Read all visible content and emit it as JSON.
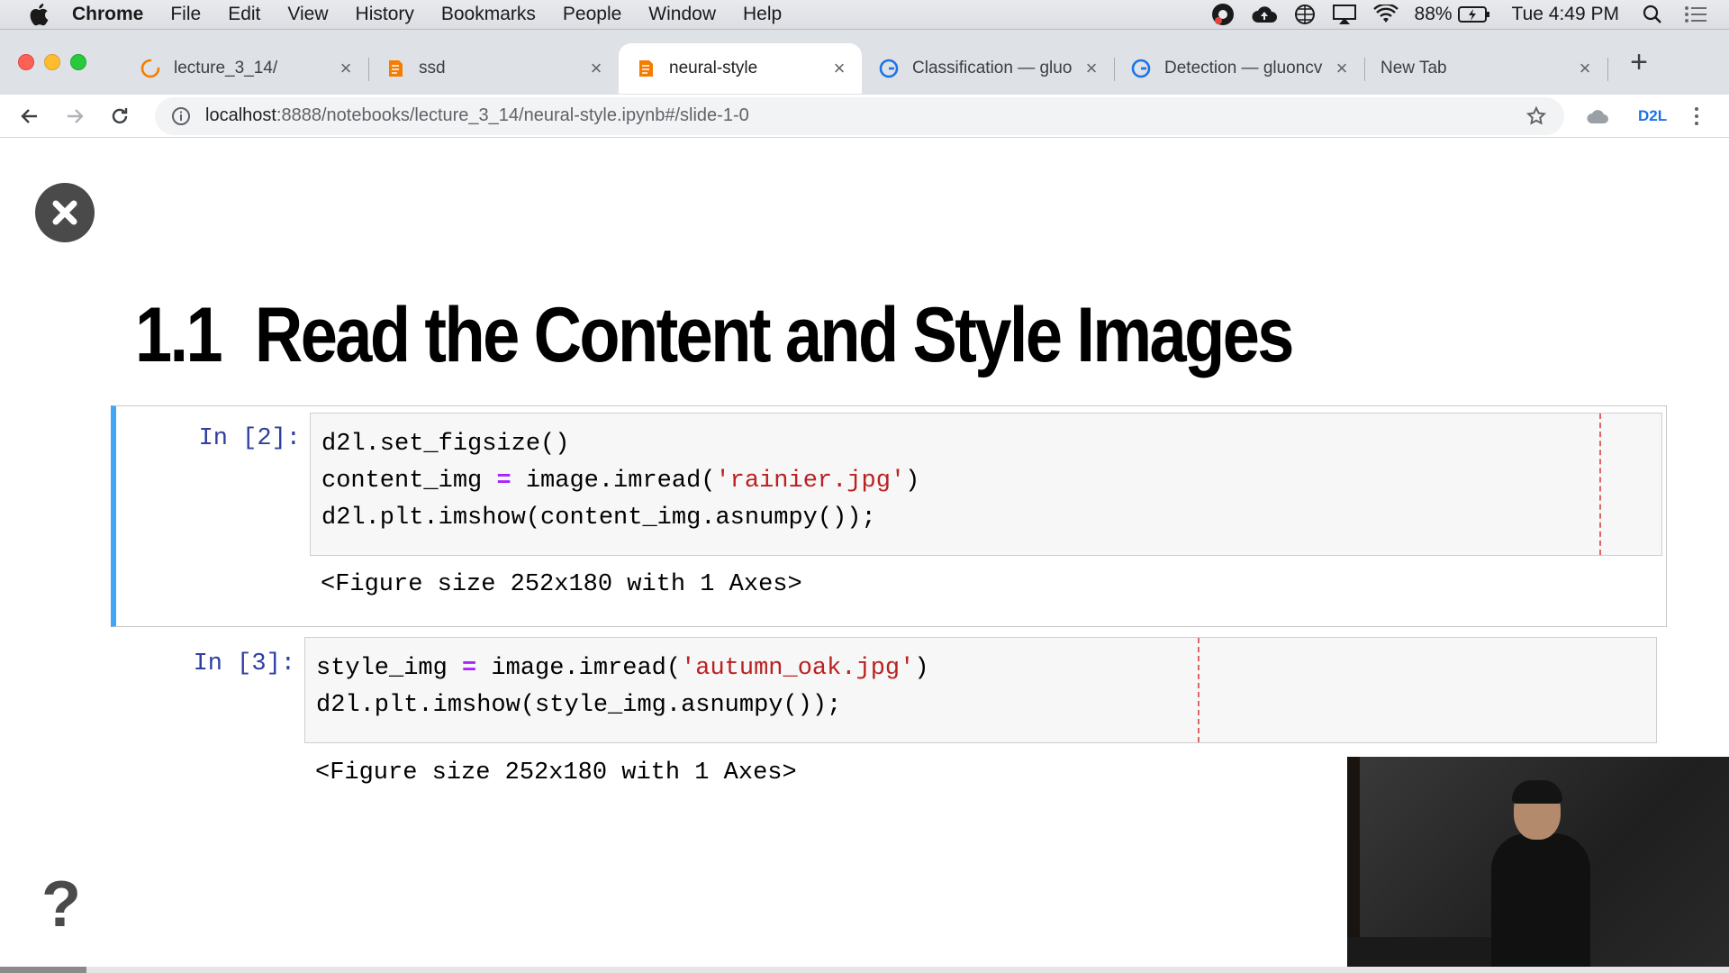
{
  "menubar": {
    "app": "Chrome",
    "items": [
      "File",
      "Edit",
      "View",
      "History",
      "Bookmarks",
      "People",
      "Window",
      "Help"
    ],
    "battery": "88%",
    "clock": "Tue 4:49 PM"
  },
  "tabs": [
    {
      "title": "lecture_3_14/",
      "icon": "loading-spinner-icon"
    },
    {
      "title": "ssd",
      "icon": "jupyter-notebook-icon"
    },
    {
      "title": "neural-style",
      "icon": "jupyter-notebook-icon",
      "active": true
    },
    {
      "title": "Classification — gluo",
      "icon": "gluoncv-icon"
    },
    {
      "title": "Detection — gluoncv",
      "icon": "gluoncv-icon"
    },
    {
      "title": "New Tab",
      "icon": ""
    }
  ],
  "toolbar": {
    "url_host": "localhost",
    "url_path": ":8888/notebooks/lecture_3_14/neural-style.ipynb#/slide-1-0",
    "extension_label": "D2L"
  },
  "slide": {
    "section_number": "1.1",
    "heading": "Read the Content and Style Images",
    "help_symbol": "?",
    "progress": 0.05
  },
  "cells": [
    {
      "prompt": "In [2]:",
      "lines": [
        [
          {
            "t": "d2l.set_figsize()",
            "c": ""
          }
        ],
        [
          {
            "t": "content_img ",
            "c": ""
          },
          {
            "t": "=",
            "c": "op"
          },
          {
            "t": " image.imread(",
            "c": ""
          },
          {
            "t": "'rainier.jpg'",
            "c": "str"
          },
          {
            "t": ")",
            "c": ""
          }
        ],
        [
          {
            "t": "d2l.plt.imshow(content_img.asnumpy());",
            "c": ""
          }
        ]
      ],
      "output": "<Figure size 252x180 with 1 Axes>"
    },
    {
      "prompt": "In [3]:",
      "lines": [
        [
          {
            "t": "style_img ",
            "c": ""
          },
          {
            "t": "=",
            "c": "op"
          },
          {
            "t": " image.imread(",
            "c": ""
          },
          {
            "t": "'autumn_oak.jpg'",
            "c": "str"
          },
          {
            "t": ")",
            "c": ""
          }
        ],
        [
          {
            "t": "d2l.plt.imshow(style_img.asnumpy());",
            "c": ""
          }
        ]
      ],
      "output": "<Figure size 252x180 with 1 Axes>"
    }
  ],
  "colors": {
    "selected_cell_border": "#42a5f5",
    "prompt": "#303f9f",
    "string": "#ba2121",
    "operator": "#aa22ff",
    "chrome_accent": "#1a73e8"
  }
}
